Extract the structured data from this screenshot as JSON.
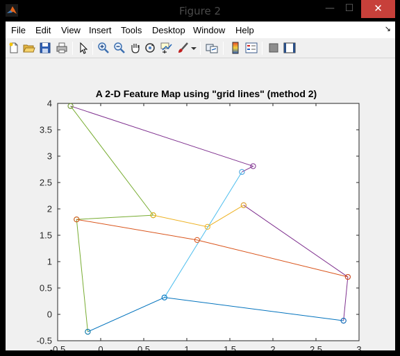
{
  "window": {
    "title": "Figure 2",
    "minimize_glyph": "—",
    "maximize_glyph": "☐",
    "close_glyph": "✕"
  },
  "menu": [
    "File",
    "Edit",
    "View",
    "Insert",
    "Tools",
    "Desktop",
    "Window",
    "Help"
  ],
  "toolbar_icons": [
    "new-figure-icon",
    "open-file-icon",
    "save-icon",
    "print-icon",
    "edit-plot-arrow-icon",
    "zoom-in-icon",
    "zoom-out-icon",
    "pan-hand-icon",
    "rotate-3d-icon",
    "data-cursor-icon",
    "brush-icon",
    "brush-dropdown-icon",
    "link-plot-icon",
    "colorbar-icon",
    "legend-icon",
    "hide-plot-tools-icon",
    "show-plot-tools-icon"
  ],
  "colors": {
    "purple": "#7E2F8E",
    "olive": "#77AC30",
    "orange": "#EDB120",
    "red": "#D95319",
    "cyan": "#4DBEEE",
    "blue": "#0072BD"
  },
  "chart_data": {
    "type": "line",
    "title": "A 2-D Feature Map using \"grid lines\" (method 2)",
    "xlim": [
      -0.5,
      3
    ],
    "ylim": [
      -0.5,
      4
    ],
    "xticks": [
      "-0.5",
      "0",
      "0.5",
      "1",
      "1.5",
      "2",
      "2.5",
      "3"
    ],
    "yticks": [
      "-0.5",
      "0",
      "0.5",
      "1",
      "1.5",
      "2",
      "2.5",
      "3",
      "3.5",
      "4"
    ],
    "grid": false,
    "marker": "circle",
    "series": [
      {
        "color": "#7E2F8E",
        "x": [
          -0.35,
          1.77,
          1.64
        ],
        "y": [
          3.95,
          2.81,
          2.7
        ]
      },
      {
        "color": "#7E2F8E",
        "x": [
          1.66,
          2.87,
          2.82
        ],
        "y": [
          2.07,
          0.71,
          -0.12
        ]
      },
      {
        "color": "#77AC30",
        "x": [
          -0.35,
          0.61
        ],
        "y": [
          3.95,
          1.88
        ]
      },
      {
        "color": "#77AC30",
        "x": [
          -0.15,
          -0.28,
          0.61
        ],
        "y": [
          -0.33,
          1.8,
          1.88
        ]
      },
      {
        "color": "#EDB120",
        "x": [
          0.61,
          1.24,
          1.66
        ],
        "y": [
          1.88,
          1.66,
          2.07
        ]
      },
      {
        "color": "#D95319",
        "x": [
          -0.28,
          1.12,
          2.87
        ],
        "y": [
          1.8,
          1.41,
          0.71
        ]
      },
      {
        "color": "#4DBEEE",
        "x": [
          0.74,
          1.64
        ],
        "y": [
          0.32,
          2.7
        ]
      },
      {
        "color": "#0072BD",
        "x": [
          -0.15,
          0.74,
          2.82
        ],
        "y": [
          -0.33,
          0.32,
          -0.12
        ]
      }
    ]
  }
}
